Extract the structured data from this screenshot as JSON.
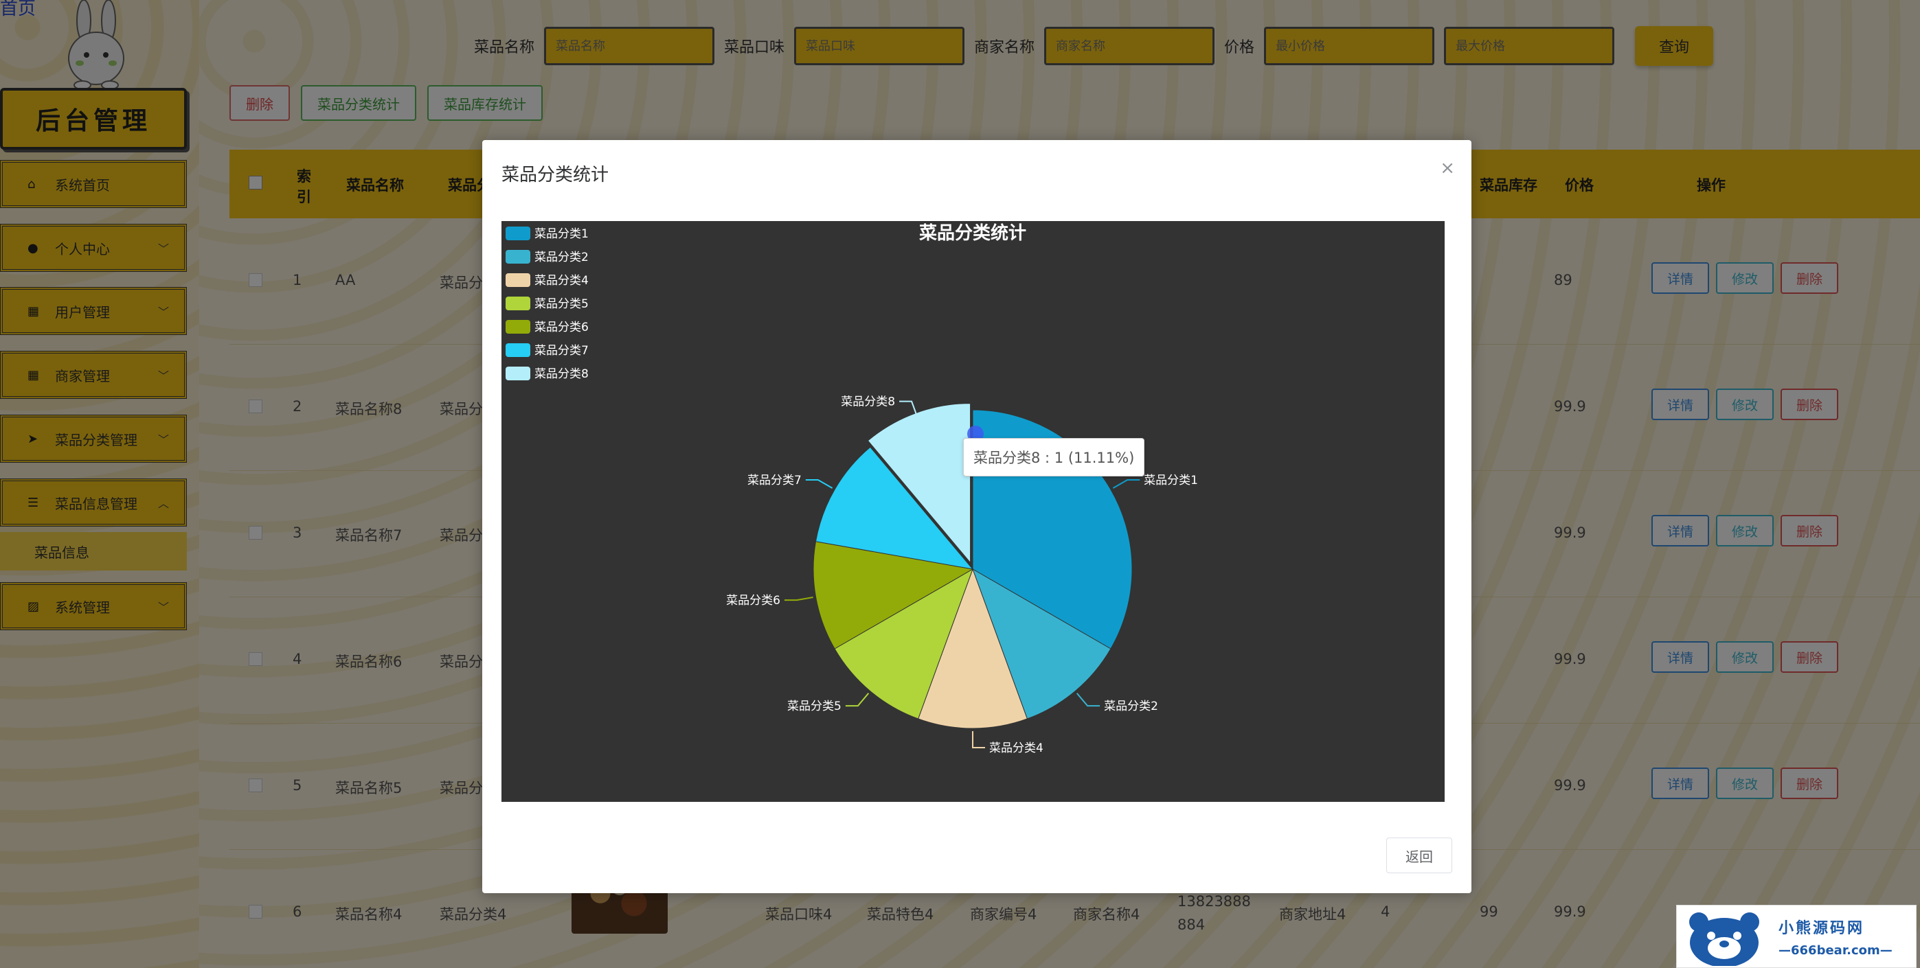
{
  "sidebar": {
    "top_link": "首页",
    "title": "后台管理",
    "items": [
      {
        "label": "系统首页",
        "icon": "home-icon",
        "expandable": false
      },
      {
        "label": "个人中心",
        "icon": "user-icon",
        "expandable": true
      },
      {
        "label": "用户管理",
        "icon": "grid-icon",
        "expandable": true
      },
      {
        "label": "商家管理",
        "icon": "grid-icon",
        "expandable": true
      },
      {
        "label": "菜品分类管理",
        "icon": "send-icon",
        "expandable": true
      },
      {
        "label": "菜品信息管理",
        "icon": "list-icon",
        "expandable": true,
        "expanded": true
      },
      {
        "label": "系统管理",
        "icon": "chart-icon",
        "expandable": true
      }
    ],
    "submenu_item": "菜品信息"
  },
  "search": {
    "dish_name_label": "菜品名称",
    "dish_name_placeholder": "菜品名称",
    "taste_label": "菜品口味",
    "taste_placeholder": "菜品口味",
    "merchant_label": "商家名称",
    "merchant_placeholder": "商家名称",
    "price_label": "价格",
    "min_price_placeholder": "最小价格",
    "max_price_placeholder": "最大价格",
    "query_button": "查询"
  },
  "actions": {
    "delete": "删除",
    "category_stats": "菜品分类统计",
    "stock_stats": "菜品库存统计"
  },
  "table": {
    "headers": {
      "index": "索引",
      "dish_name": "菜品名称",
      "category": "菜品分",
      "stock": "菜品库存",
      "price": "价格",
      "operations": "操作"
    },
    "op_labels": {
      "detail": "详情",
      "edit": "修改",
      "delete": "删除"
    },
    "rows": [
      {
        "index": "1",
        "name": "AA",
        "category": "菜品分",
        "price": "89"
      },
      {
        "index": "2",
        "name": "菜品名称8",
        "category": "菜品分",
        "price": "99.9"
      },
      {
        "index": "3",
        "name": "菜品名称7",
        "category": "菜品分",
        "price": "99.9"
      },
      {
        "index": "4",
        "name": "菜品名称6",
        "category": "菜品分",
        "price": "99.9"
      },
      {
        "index": "5",
        "name": "菜品名称5",
        "category": "菜品分",
        "price": "99.9"
      },
      {
        "index": "6",
        "name": "菜品名称4",
        "category": "菜品分类4",
        "taste": "菜品口味4",
        "feature": "菜品特色4",
        "merchant_no": "商家编号4",
        "merchant_name": "商家名称4",
        "phone": "13823888884",
        "address": "商家地址4",
        "col4": "4",
        "stock": "99",
        "price": "99.9"
      }
    ]
  },
  "dialog": {
    "title": "菜品分类统计",
    "close_glyph": "×",
    "return_button": "返回",
    "tooltip": "菜品分类8 : 1 (11.11%)"
  },
  "chart_data": {
    "type": "pie",
    "title": "菜品分类统计",
    "legend_position": "top-left",
    "slices": [
      {
        "name": "菜品分类1",
        "value": 3,
        "color": "#0f9ccc"
      },
      {
        "name": "菜品分类2",
        "value": 1,
        "color": "#38b3cf"
      },
      {
        "name": "菜品分类4",
        "value": 1,
        "color": "#efd3a8"
      },
      {
        "name": "菜品分类5",
        "value": 1,
        "color": "#afd53a"
      },
      {
        "name": "菜品分类6",
        "value": 1,
        "color": "#93ab08"
      },
      {
        "name": "菜品分类7",
        "value": 1,
        "color": "#26cdf4"
      },
      {
        "name": "菜品分类8",
        "value": 1,
        "color": "#b4eefb"
      }
    ]
  },
  "watermark": {
    "site_name": "小熊源码网",
    "url": "—666bear.com—"
  }
}
